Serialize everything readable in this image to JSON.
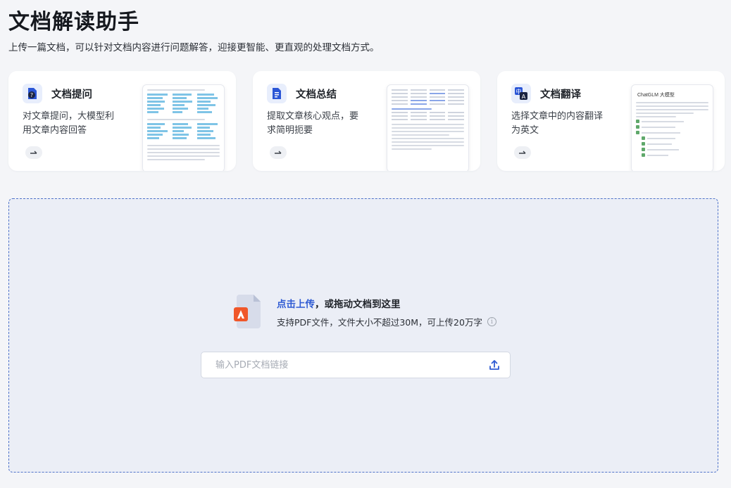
{
  "header": {
    "title": "文档解读助手",
    "subtitle": "上传一篇文档，可以针对文档内容进行问题解答，迎接更智能、更直观的处理文档方式。"
  },
  "cards": [
    {
      "title": "文档提问",
      "description": "对文章提问，大模型利用文章内容回答",
      "icon": "document-question-icon"
    },
    {
      "title": "文档总结",
      "description": "提取文章核心观点，要求简明扼要",
      "icon": "document-list-icon"
    },
    {
      "title": "文档翻译",
      "description": "选择文章中的内容翻译为英文",
      "icon": "translate-icon",
      "thumbnail_title": "ChatGLM 大模型"
    }
  ],
  "upload": {
    "link_text": "点击上传",
    "rest_text": "，或拖动文档到这里",
    "hint": "支持PDF文件，文件大小不超过30M，可上传20万字",
    "url_placeholder": "输入PDF文档链接"
  },
  "colors": {
    "accent": "#2f5bd3",
    "pdf_red": "#f0572a",
    "dropzone_bg": "#ebeef6",
    "dropzone_border": "#4e72c9"
  }
}
